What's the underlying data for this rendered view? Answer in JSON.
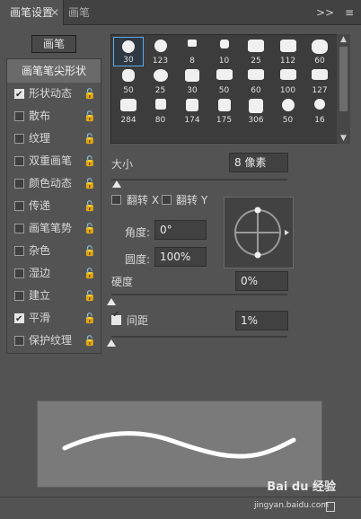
{
  "tabs": [
    {
      "label": "画笔设置",
      "active": true
    },
    {
      "label": "画笔",
      "active": false
    }
  ],
  "tab_tools": {
    "collapse": ">>",
    "menu": "≡"
  },
  "brush_button": "画笔",
  "list": {
    "header": "画笔笔尖形状",
    "items": [
      {
        "label": "形状动态",
        "checked": true
      },
      {
        "label": "散布",
        "checked": false
      },
      {
        "label": "纹理",
        "checked": false
      },
      {
        "label": "双重画笔",
        "checked": false
      },
      {
        "label": "颜色动态",
        "checked": false
      },
      {
        "label": "传递",
        "checked": false
      },
      {
        "label": "画笔笔势",
        "checked": false
      },
      {
        "label": "杂色",
        "checked": false
      },
      {
        "label": "湿边",
        "checked": false
      },
      {
        "label": "建立",
        "checked": false
      },
      {
        "label": "平滑",
        "checked": true
      },
      {
        "label": "保护纹理",
        "checked": false
      }
    ]
  },
  "brushes": [
    {
      "size": "30",
      "selected": true
    },
    {
      "size": "123"
    },
    {
      "size": "8"
    },
    {
      "size": "10"
    },
    {
      "size": "25"
    },
    {
      "size": "112"
    },
    {
      "size": "60"
    },
    {
      "size": "50"
    },
    {
      "size": "25"
    },
    {
      "size": "30"
    },
    {
      "size": "50"
    },
    {
      "size": "60"
    },
    {
      "size": "100"
    },
    {
      "size": "127"
    },
    {
      "size": "284"
    },
    {
      "size": "80"
    },
    {
      "size": "174"
    },
    {
      "size": "175"
    },
    {
      "size": "306"
    },
    {
      "size": "50"
    },
    {
      "size": "16"
    }
  ],
  "size": {
    "label": "大小",
    "value": "8 像素"
  },
  "flip": {
    "x_label": "翻转 X",
    "y_label": "翻转 Y"
  },
  "angle": {
    "label": "角度:",
    "value": "0°"
  },
  "roundness": {
    "label": "圆度:",
    "value": "100%"
  },
  "hardness": {
    "label": "硬度",
    "value": "0%"
  },
  "spacing": {
    "label": "间距",
    "value": "1%",
    "checked": true
  },
  "watermark": {
    "brand": "Bai du 经验",
    "url": "jingyan.baidu.com"
  }
}
